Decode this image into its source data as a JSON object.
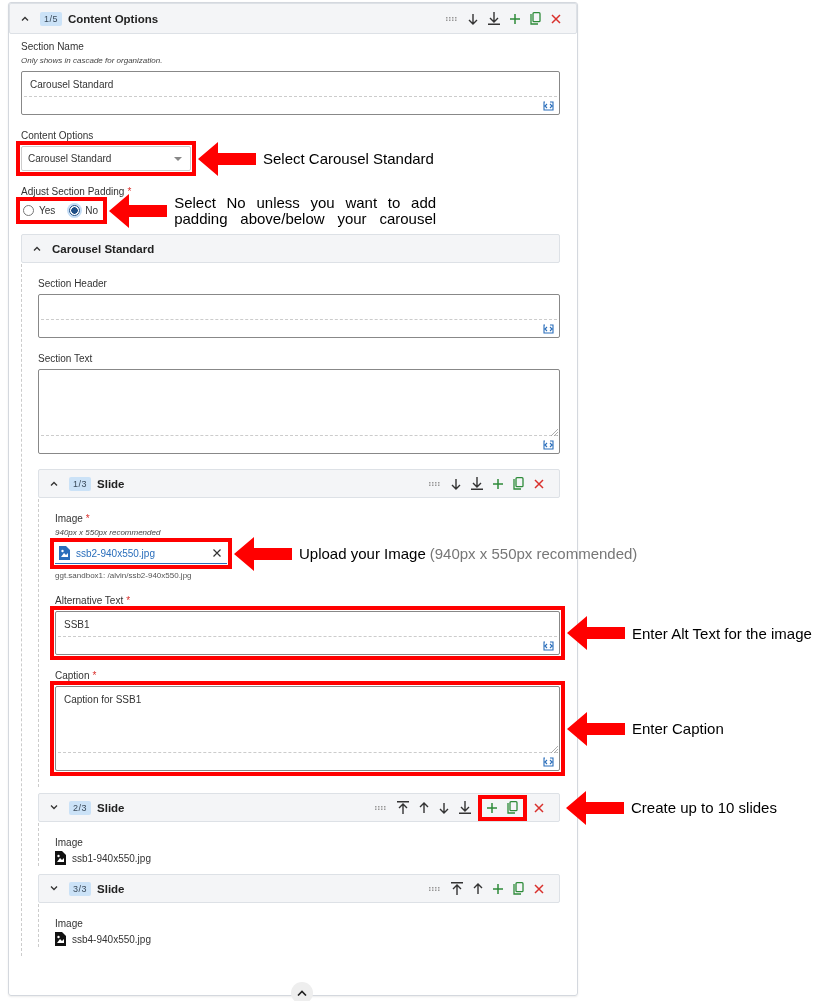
{
  "section": {
    "counter": "1/5",
    "title": "Content Options",
    "expanded": true,
    "actions": [
      {
        "kind": "drag"
      },
      {
        "kind": "down"
      },
      {
        "kind": "bottom"
      },
      {
        "kind": "add"
      },
      {
        "kind": "copy"
      },
      {
        "kind": "delete"
      }
    ],
    "fields": [
      {
        "kind": "text",
        "label": "Section Name",
        "help": "Only shows in cascade for organization.",
        "value": "Carousel Standard"
      },
      {
        "kind": "select",
        "label": "Content Options",
        "value": "Carousel Standard",
        "highlighted": true,
        "callout": "Select Carousel Standard"
      },
      {
        "kind": "radio",
        "label": "Adjust Section Padding",
        "required_mark": "*",
        "options": [
          {
            "label": "Yes",
            "selected": false
          },
          {
            "label": "No",
            "selected": true
          }
        ],
        "highlighted": true,
        "callout": "Select No unless you want to add padding above/below your carousel"
      },
      {
        "kind": "group",
        "title": "Carousel Standard",
        "expanded": true,
        "fields": [
          {
            "kind": "text",
            "label": "Section Header"
          },
          {
            "kind": "textarea",
            "label": "Section Text"
          }
        ],
        "slides": [
          {
            "counter": "1/3",
            "title": "Slide",
            "expanded": true,
            "actions": [
              {
                "kind": "drag",
                "highlighted": false
              },
              {
                "kind": "down",
                "highlighted": false
              },
              {
                "kind": "bottom",
                "highlighted": false
              },
              {
                "kind": "add",
                "highlighted": false
              },
              {
                "kind": "copy",
                "highlighted": false
              },
              {
                "kind": "delete",
                "highlighted": false
              }
            ],
            "fields": [
              {
                "kind": "image",
                "label": "Image",
                "required_mark": "*",
                "help": "940px x 550px recommended",
                "file": "ssb2-940x550.jpg",
                "path": "ggt.sandbox1: /alvin/ssb2-940x550.jpg",
                "highlighted": true,
                "callout": "Upload your Image",
                "callout_note": "(940px x 550px recommended)"
              },
              {
                "kind": "text",
                "label": "Alternative Text",
                "required_mark": "*",
                "value": "SSB1",
                "highlighted": true,
                "callout": "Enter Alt Text for the image"
              },
              {
                "kind": "textarea",
                "label": "Caption",
                "required_mark": "*",
                "value": "Caption for SSB1",
                "highlighted": true,
                "callout": "Enter Caption"
              }
            ]
          },
          {
            "counter": "2/3",
            "title": "Slide",
            "expanded": false,
            "callout": "Create up to 10 slides",
            "actions": [
              {
                "kind": "drag",
                "highlighted": false
              },
              {
                "kind": "top",
                "highlighted": false
              },
              {
                "kind": "up",
                "highlighted": false
              },
              {
                "kind": "down",
                "highlighted": false
              },
              {
                "kind": "bottom",
                "highlighted": false
              },
              {
                "kind": "add",
                "highlighted": true
              },
              {
                "kind": "copy",
                "highlighted": true
              },
              {
                "kind": "delete",
                "highlighted": false
              }
            ],
            "fields": [
              {
                "kind": "file_summary",
                "label": "Image",
                "file": "ssb1-940x550.jpg"
              }
            ]
          },
          {
            "counter": "3/3",
            "title": "Slide",
            "expanded": false,
            "actions": [
              {
                "kind": "drag",
                "highlighted": false
              },
              {
                "kind": "top",
                "highlighted": false
              },
              {
                "kind": "up",
                "highlighted": false
              },
              {
                "kind": "add",
                "highlighted": false
              },
              {
                "kind": "copy",
                "highlighted": false
              },
              {
                "kind": "delete",
                "highlighted": false
              }
            ],
            "fields": [
              {
                "kind": "file_summary",
                "label": "Image",
                "file": "ssb4-940x550.jpg"
              }
            ]
          }
        ]
      }
    ]
  }
}
